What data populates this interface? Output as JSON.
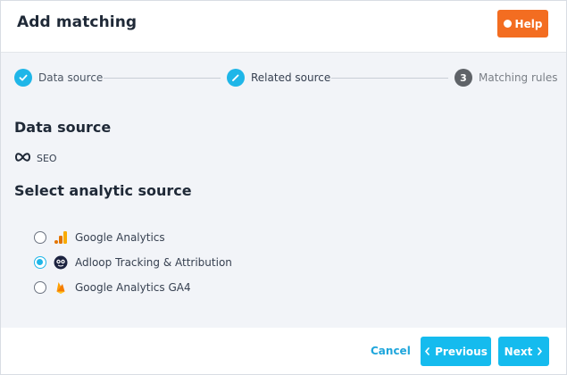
{
  "header": {
    "title": "Add matching",
    "help_label": "Help"
  },
  "stepper": {
    "steps": [
      {
        "label": "Data source",
        "state": "completed",
        "icon": "check-icon"
      },
      {
        "label": "Related source",
        "state": "active",
        "icon": "pencil-icon"
      },
      {
        "label": "Matching rules",
        "state": "pending",
        "number": "3"
      }
    ]
  },
  "data_source": {
    "heading": "Data source",
    "value": "SEO",
    "icon": "infinity-icon"
  },
  "analytic": {
    "heading": "Select analytic source",
    "options": [
      {
        "label": "Google Analytics",
        "icon": "google-analytics-icon",
        "selected": false
      },
      {
        "label": "Adloop Tracking & Attribution",
        "icon": "adloop-icon",
        "selected": true
      },
      {
        "label": "Google Analytics GA4",
        "icon": "firebase-icon",
        "selected": false
      }
    ]
  },
  "footer": {
    "cancel_label": "Cancel",
    "previous_label": "Previous",
    "next_label": "Next"
  },
  "colors": {
    "accent": "#1fb6e8",
    "help": "#f36d21",
    "body_bg": "#f2f4f8"
  }
}
